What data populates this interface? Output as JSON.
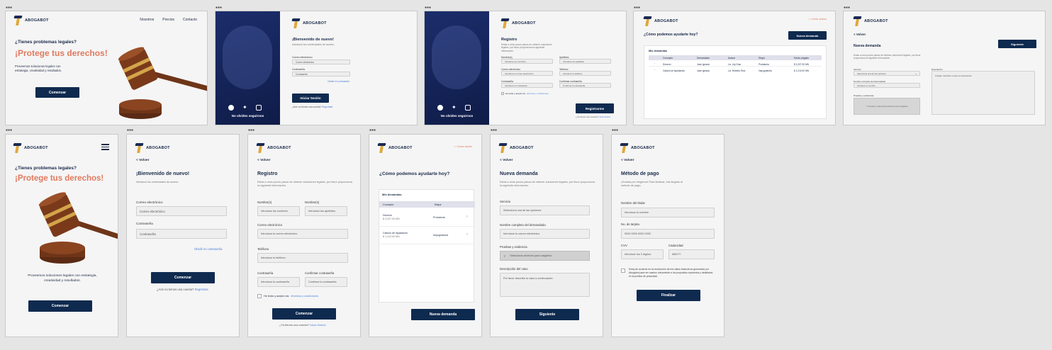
{
  "brand": "ABOGABOT",
  "f1": {
    "nav": [
      "Nosotros",
      "Precios",
      "Contacto"
    ],
    "question": "¿Tienes problemas legales?",
    "headline": "¡Protege tus derechos!",
    "desc": "Proveemos soluciones legales con estrategia, creatividad y resultados.",
    "cta": "Comenzar"
  },
  "f2": {
    "title": "¡Bienvenido de nuevo!",
    "subtitle": "Introduce tus credenciales de acceso",
    "email_label": "Correo electrónico",
    "email_ph": "Correo electrónico",
    "pass_label": "Contraseña",
    "pass_ph": "Contraseña",
    "forgot": "Olvidé mi contraseña",
    "submit": "Iniciar Sesión",
    "no_account": "¿Aún no tienes una cuenta?",
    "register_link": "Regístrate",
    "follow": "No olvides seguirnos"
  },
  "f3": {
    "title": "Registro",
    "desc": "Estas a unos pocos pasos de obtener soluciones legales, por favor proporciona la siguiente información.",
    "nombre_label": "Nombre(s)",
    "nombre_ph": "Introduce tus nombres",
    "apellido_label": "Apellidos",
    "apellido_ph": "Introduce tus apellidos",
    "correo_label": "Correo electrónico",
    "correo_ph": "Introduce tu correo electrónico",
    "tel_label": "Teléfono",
    "tel_ph": "Introduce tu teléfono",
    "pass_label": "Contraseña",
    "pass_ph": "Introduce tu contraseña",
    "confirm_label": "Confirmar contraseña",
    "confirm_ph": "Confirma tu contraseña",
    "terms": "He leído y acepto los",
    "terms_link": "términos y condiciones",
    "submit": "Registrarme",
    "has_account": "¿Ya tienes una cuenta?",
    "login_link": "Inicia Sesión",
    "follow": "No olvides seguirnos"
  },
  "f4": {
    "logout": "Cerrar sesión",
    "question": "¿Cómo podemos ayudarte hoy?",
    "new_btn": "Nueva demanda",
    "card_title": "Mis demandas",
    "cols": [
      "Concepto",
      "Demandado",
      "Asesor",
      "Etapa",
      "Monto pagado"
    ],
    "rows": [
      [
        "Divorcio",
        "Juan Ignacio",
        "Lic. Lily Díaz",
        "Probatoria",
        "$ 3,207.00 MN"
      ],
      [
        "Cálculo de liquidación",
        "Juan Ignacio",
        "Lic. Roberto Ruiz",
        "Impugnatoria",
        "$ 1,210.00 MN"
      ]
    ]
  },
  "f5": {
    "back": "< Volver",
    "title": "Nueva demanda",
    "desc": "Estas a unos pocos pasos de obtener soluciones legales, por favor proporciona la siguiente información.",
    "next": "Siguiente",
    "service_label": "Servicio",
    "service_ph": "Selecciona una de las opciones",
    "name_label": "Nombre completo del demandado",
    "name_ph": "Introduce tu nombre",
    "evid_label": "Pruebas y evidencias",
    "evid_ph": "Arrastra o selecciona archivos para cargarlos",
    "desc_label": "Descripción",
    "desc_ph": "Trabajo: describe tu caso a continuación"
  },
  "f6": {
    "question": "¿Tienes problemas legales?",
    "headline": "¡Protege tus derechos!",
    "desc": "Proveemos soluciones legales con estrategia, creatividad y resultados.",
    "cta": "Comenzar"
  },
  "f7": {
    "back": "< Volver",
    "title": "¡Bienvenido de nuevo!",
    "subtitle": "Introduce tus credenciales de acceso",
    "email_label": "Correo electrónico",
    "email_ph": "Correo electrónico",
    "pass_label": "Contraseña",
    "pass_ph": "Contraseña",
    "forgot": "Olvidé mi contraseña",
    "submit": "Comenzar",
    "no_account": "¿Aún no tienes una cuenta?",
    "register_link": "Regístrate"
  },
  "f8": {
    "back": "< Volver",
    "title": "Registro",
    "desc": "Estas a unos pocos pasos de obtener soluciones legales, por favor proporciona la siguiente información.",
    "nombre_label": "Nombre(s)",
    "nombre_ph": "Introduce tus nombres",
    "apellido_label": "Nombre(s)",
    "apellido_ph": "Introduce tus apellidos",
    "correo_label": "Correo electrónico",
    "correo_ph": "Introduce tu correo electrónico",
    "tel_label": "Teléfono",
    "tel_ph": "Introduce tu teléfono",
    "pass_label": "Contraseña",
    "pass_ph": "Introduce tu contraseña",
    "confirm_label": "Confirmar contraseña",
    "confirm_ph": "Confirma tu contraseña",
    "terms": "He leído y acepto los",
    "terms_link": "términos y condiciones",
    "submit": "Comenzar",
    "has_account": "¿Ya tienes una cuenta?",
    "login_link": "Inicia Sesión"
  },
  "f9": {
    "logout": "Cerrar sesión",
    "question": "¿Cómo podemos ayudarte hoy?",
    "card_title": "Mis demandas",
    "cols": [
      "Concepto",
      "Etapa"
    ],
    "rows": [
      {
        "concept": "Divorcio",
        "amount": "$ 3,207.00 MN",
        "stage": "Probatoria"
      },
      {
        "concept": "Cálculo de liquidación",
        "amount": "$ 1,210.00 MN",
        "stage": "Impugnatoria"
      }
    ],
    "new_btn": "Nueva demanda"
  },
  "f10": {
    "back": "< Volver",
    "title": "Nueva demanda",
    "desc": "Estas a unos pocos pasos de obtener soluciones legales, por favor proporciona la siguiente información.",
    "service_label": "Servicio",
    "service_ph": "Selecciona una de las opciones",
    "name_label": "Nombre completo del demandado",
    "name_ph": "Introduce tu correo electrónico",
    "evid_label": "Pruebas y evidencia",
    "evid_ph": "Selecciona archivos para cargarlos",
    "desc_label": "Descripción del caso",
    "desc_ph": "Por favor describe tu caso a continuación",
    "next": "Siguiente"
  },
  "f11": {
    "back": "< Volver",
    "title": "Método de pago",
    "desc": "¡Gracias por elegirnos! Para finalizar, has llegado al método de pago.",
    "holder_label": "Nombre del titular",
    "holder_ph": "Introduce tu nombre",
    "card_label": "No. de tarjeta",
    "card_ph": "0000 0000 0000 0000",
    "cvv_label": "CVV",
    "cvv_ph": "Introduce los 3 dígitos",
    "exp_label": "Caducidad",
    "exp_ph": "MM/YY",
    "consent": "Estoy de acuerdo en la recolección de mis datos financieros generados por Abogabot para ser usados únicamente a los propósitos expuestos y detallados en la política de privacidad",
    "submit": "Finalizar"
  }
}
